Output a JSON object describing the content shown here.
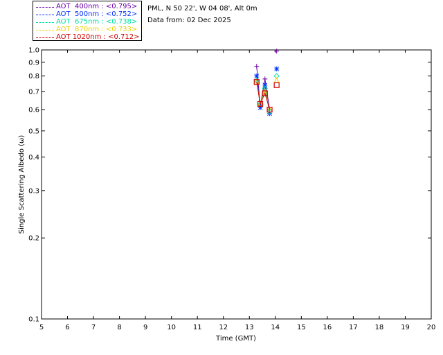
{
  "header": {
    "site": "PML, N 50 22', W 04 08', Alt 0m",
    "date_line": "Data from: 02 Dec 2025"
  },
  "legend": [
    {
      "label": "AOT  400nm : <0.795>",
      "color": "#6a00a8"
    },
    {
      "label": "AOT  500nm : <0.752>",
      "color": "#0030ff"
    },
    {
      "label": "AOT  675nm : <0.738>",
      "color": "#00e0a0"
    },
    {
      "label": "AOT  870nm : <0.733>",
      "color": "#f0d000"
    },
    {
      "label": "AOT 1020nm : <0.712>",
      "color": "#d00000"
    }
  ],
  "chart_data": {
    "type": "scatter",
    "title": "",
    "xlabel": "Time (GMT)",
    "ylabel": "Single Scattering Albedo (ω)",
    "xlim": [
      5,
      20
    ],
    "ylim": [
      0.1,
      1.0
    ],
    "yscale": "log",
    "x_ticks": [
      "5",
      "6",
      "7",
      "8",
      "9",
      "10",
      "11",
      "12",
      "13",
      "14",
      "15",
      "16",
      "17",
      "18",
      "19",
      "20"
    ],
    "y_ticks": [
      "0.1",
      "0.2",
      "0.3",
      "0.4",
      "0.5",
      "0.6",
      "0.7",
      "0.8",
      "0.9",
      "1.0"
    ],
    "series": [
      {
        "name": "AOT  400nm",
        "color": "#6a00a8",
        "marker": "plus",
        "x": [
          13.28,
          13.42,
          13.6,
          13.78,
          14.05
        ],
        "y": [
          0.87,
          0.62,
          0.78,
          0.6,
          0.99
        ]
      },
      {
        "name": "AOT  500nm",
        "color": "#0030ff",
        "marker": "star",
        "x": [
          13.28,
          13.42,
          13.6,
          13.78,
          14.05
        ],
        "y": [
          0.8,
          0.61,
          0.74,
          0.58,
          0.85
        ]
      },
      {
        "name": "AOT  675nm",
        "color": "#00e0a0",
        "marker": "diamond",
        "x": [
          13.28,
          13.42,
          13.6,
          13.78,
          14.05
        ],
        "y": [
          0.77,
          0.63,
          0.72,
          0.59,
          0.8
        ]
      },
      {
        "name": "AOT  870nm",
        "color": "#f0d000",
        "marker": "triangle",
        "x": [
          13.28,
          13.42,
          13.6,
          13.78,
          14.05
        ],
        "y": [
          0.76,
          0.63,
          0.7,
          0.6,
          0.77
        ]
      },
      {
        "name": "AOT 1020nm",
        "color": "#d00000",
        "marker": "square",
        "x": [
          13.28,
          13.42,
          13.6,
          13.78,
          14.05
        ],
        "y": [
          0.76,
          0.63,
          0.69,
          0.6,
          0.74
        ]
      }
    ]
  }
}
